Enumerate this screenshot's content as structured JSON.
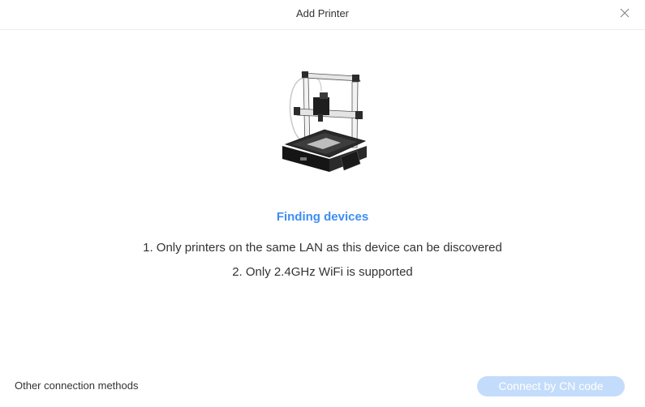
{
  "dialog": {
    "title": "Add Printer",
    "close_icon": "close-icon"
  },
  "illustration": {
    "icon": "3d-printer-illustration"
  },
  "status": {
    "text": "Finding devices",
    "color": "#3d8ef3"
  },
  "notes": [
    "1. Only printers on the same LAN as this device can be discovered",
    "2. Only 2.4GHz WiFi is supported"
  ],
  "footer": {
    "other_methods_label": "Other connection methods",
    "connect_button_label": "Connect by CN code",
    "connect_button_state": "disabled",
    "connect_button_color": "#c4dcfb"
  }
}
